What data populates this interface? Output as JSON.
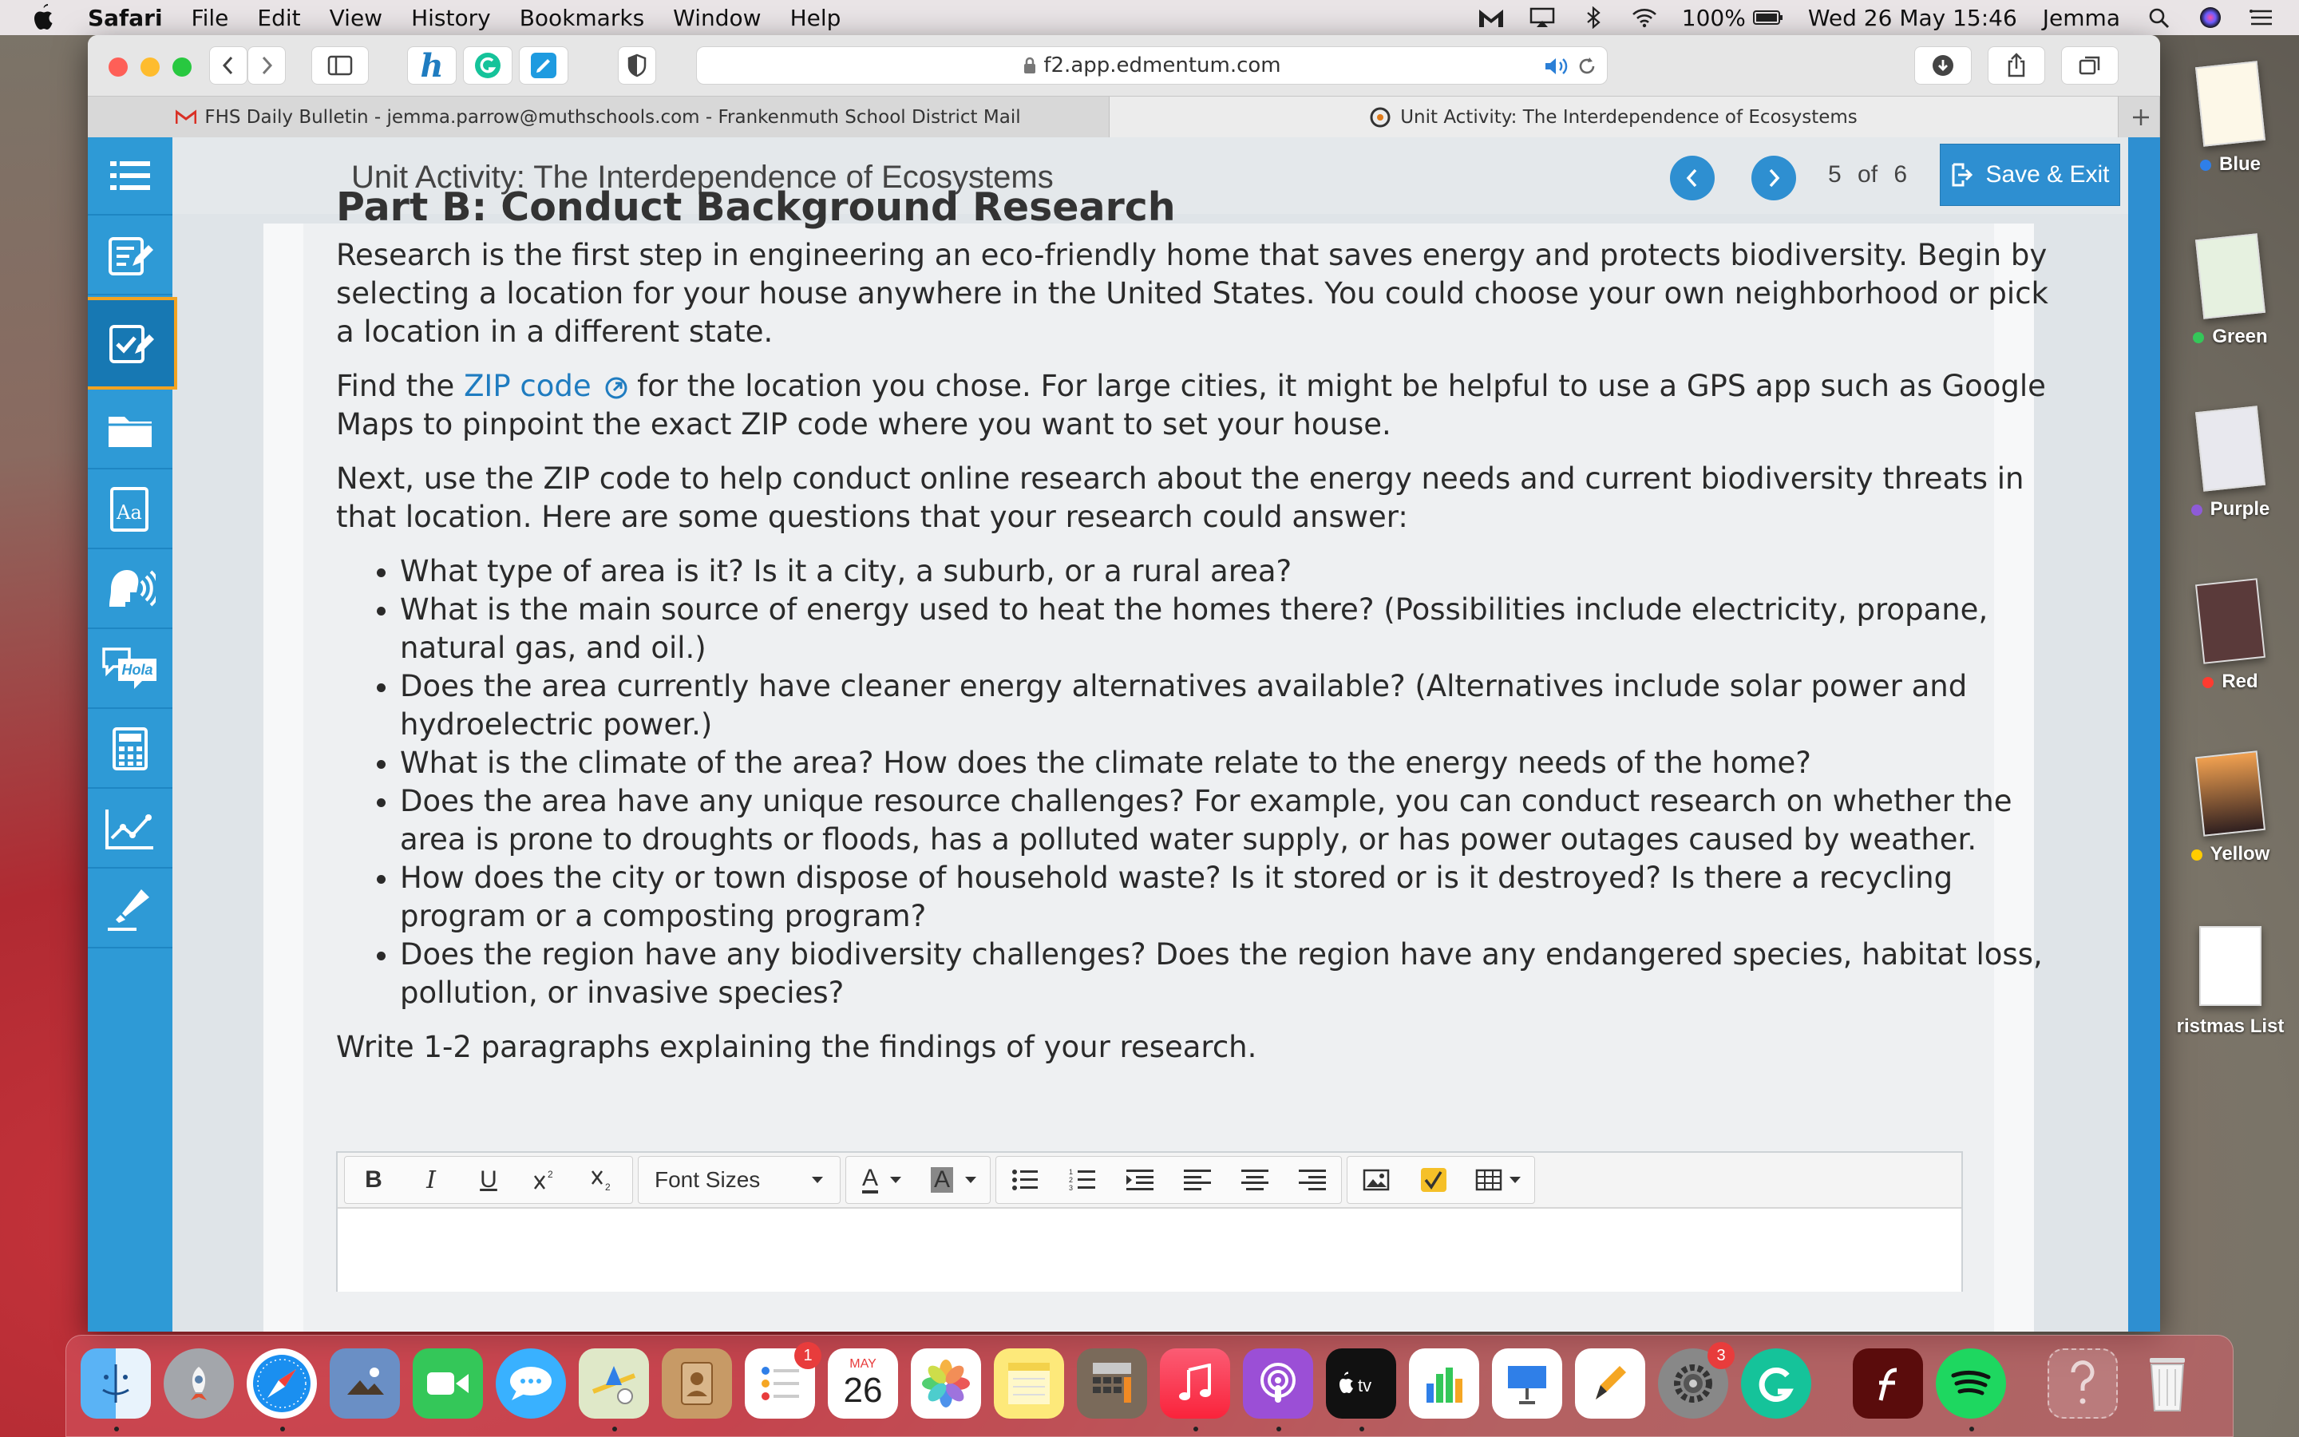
{
  "menubar": {
    "app": "Safari",
    "menus": [
      "File",
      "Edit",
      "View",
      "History",
      "Bookmarks",
      "Window",
      "Help"
    ],
    "battery": "100%",
    "datetime": "Wed 26 May  15:46",
    "user": "Jemma"
  },
  "browser": {
    "url": "f2.app.edmentum.com",
    "tabs": [
      {
        "label": "FHS Daily Bulletin - jemma.parrow@muthschools.com - Frankenmuth School District Mail",
        "active": false
      },
      {
        "label": "Unit Activity: The Interdependence of Ecosystems",
        "active": true
      }
    ]
  },
  "activity": {
    "title": "Unit Activity: The Interdependence of Ecosystems",
    "page_current": "5",
    "page_of": "of",
    "page_total": "6",
    "save_exit": "Save & Exit"
  },
  "article": {
    "heading": "Part B: Conduct Background Research",
    "p1": "Research is the first step in engineering an eco-friendly home that saves energy and protects biodiversity. Begin by selecting a location for your house anywhere in the United States. You could choose your own neighborhood or pick a location in a different state.",
    "p2_before": "Find the ",
    "p2_link": "ZIP code",
    "p2_after": " for the location you chose. For large cities, it might be helpful to use a GPS app such as Google Maps to pinpoint the exact ZIP code where you want to set your house.",
    "p3": "Next, use the ZIP code to help conduct online research about the energy needs and current biodiversity threats in that location. Here are some questions that your research could answer:",
    "questions": [
      "What type of area is it? Is it a city, a suburb, or a rural area?",
      "What is the main source of energy used to heat the homes there? (Possibilities include electricity, propane, natural gas, and oil.)",
      "Does the area currently have cleaner energy alternatives available? (Alternatives include solar power and hydroelectric power.)",
      "What is the climate of the area? How does the climate relate to the energy needs of the home?",
      "Does the area have any unique resource challenges? For example, you can conduct research on whether the area is prone to droughts or floods, has a polluted water supply, or has power outages caused by weather.",
      "How does the city or town dispose of household waste? Is it stored or is it destroyed? Is there a recycling program or a composting program?",
      "Does the region have any biodiversity challenges? Does the region have any endangered species, habitat loss, pollution, or invasive species?"
    ],
    "instruction": "Write 1-2 paragraphs explaining the findings of your research."
  },
  "editor": {
    "bold": "B",
    "italic": "I",
    "underline": "U",
    "font_sizes": "Font Sizes",
    "text_color": "A",
    "bg_color": "A"
  },
  "desktop_stack": [
    {
      "label": "Blue",
      "color": "#2f7fe8"
    },
    {
      "label": "Green",
      "color": "#34c759"
    },
    {
      "label": "Purple",
      "color": "#8e5bd8"
    },
    {
      "label": "Red",
      "color": "#ff3b30"
    },
    {
      "label": "Yellow",
      "color": "#ffcc00"
    },
    {
      "label": "ristmas List",
      "color": ""
    }
  ],
  "dock": {
    "reminders_badge": "1",
    "calendar_month": "MAY",
    "calendar_day": "26",
    "settings_badge": "3"
  },
  "colors": {
    "accent": "#2e8fd1",
    "nav_bg": "#2e9ad6",
    "active_outline": "#f2a321",
    "link": "#1f7cc0"
  }
}
